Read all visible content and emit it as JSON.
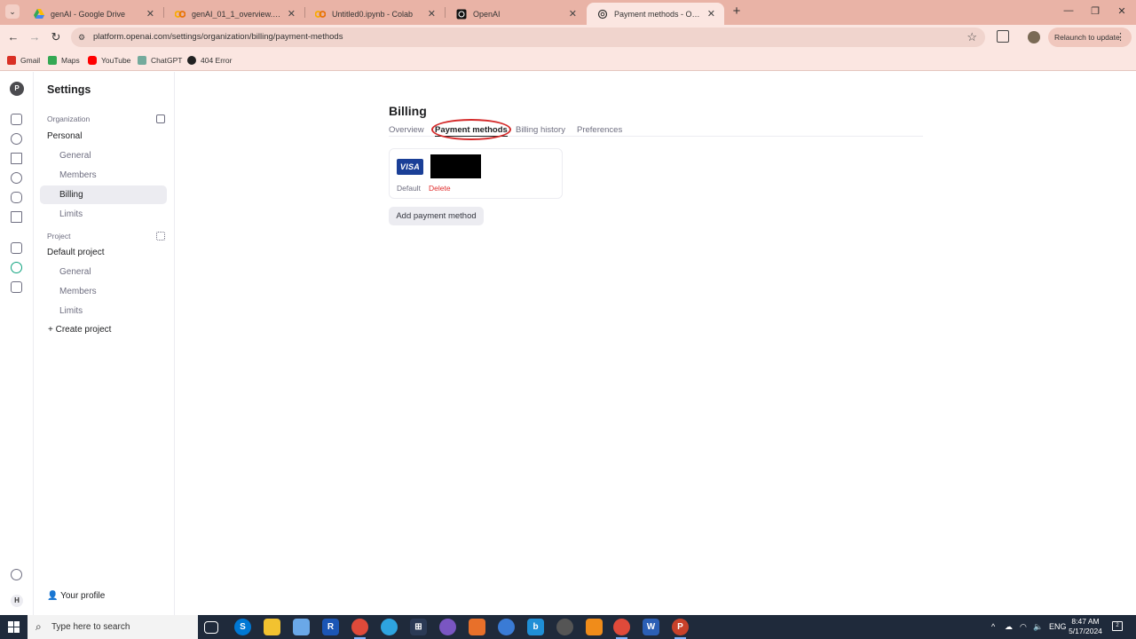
{
  "browser": {
    "tabs": [
      {
        "title": "genAI - Google Drive",
        "icon": "google-drive-icon",
        "active": false
      },
      {
        "title": "genAI_01_1_overview.ipynb - Colab",
        "icon": "colab-icon",
        "active": false
      },
      {
        "title": "Untitled0.ipynb - Colab",
        "icon": "colab-icon",
        "active": false
      },
      {
        "title": "OpenAI",
        "icon": "openai-icon",
        "active": false
      },
      {
        "title": "Payment methods - OpenAI API",
        "icon": "openai-icon",
        "active": true
      }
    ],
    "close_glyph": "✕",
    "new_tab_glyph": "+",
    "url": "platform.openai.com/settings/organization/billing/payment-methods",
    "relaunch_label": "Relaunch to update",
    "bookmarks": [
      {
        "label": "Gmail",
        "color": "#d93025"
      },
      {
        "label": "Maps",
        "color": "#34a853"
      },
      {
        "label": "YouTube",
        "color": "#ff0000"
      },
      {
        "label": "ChatGPT",
        "color": "#74aa9c"
      },
      {
        "label": "404 Error",
        "color": "#222222"
      }
    ]
  },
  "rail": {
    "logo_letter": "P",
    "user_letter": "H"
  },
  "sidebar": {
    "title": "Settings",
    "organization_label": "Organization",
    "personal_label": "Personal",
    "org_items": [
      "General",
      "Members",
      "Billing",
      "Limits"
    ],
    "active_item": "Billing",
    "project_label": "Project",
    "default_project_label": "Default project",
    "project_items": [
      "General",
      "Members",
      "Limits"
    ],
    "create_project_label": "Create project",
    "profile_label": "Your profile"
  },
  "billing": {
    "title": "Billing",
    "tabs": [
      "Overview",
      "Payment methods",
      "Billing history",
      "Preferences"
    ],
    "active_tab": "Payment methods",
    "card": {
      "brand": "VISA",
      "default_label": "Default",
      "delete_label": "Delete"
    },
    "add_button_label": "Add payment method"
  },
  "taskbar": {
    "search_placeholder": "Type here to search",
    "language": "ENG",
    "time": "8:47 AM",
    "date": "5/17/2024",
    "notification_count": "2"
  },
  "colors": {
    "accent": "#10a37f",
    "danger": "#e02d2d",
    "annotation": "#d42a2a",
    "visa_blue": "#1a3f97"
  }
}
